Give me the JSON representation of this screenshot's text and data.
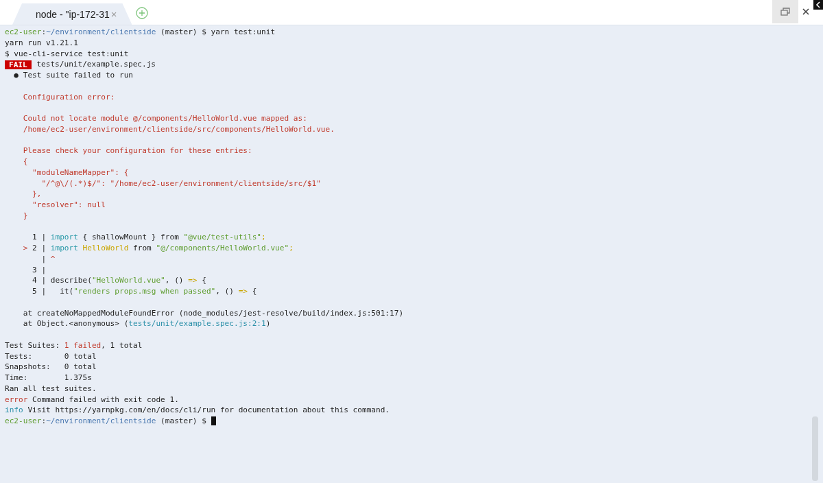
{
  "tabs": [
    {
      "title": "node - \"ip-172-31",
      "close": "×",
      "selected": true
    }
  ],
  "terminal": {
    "cursor": true,
    "lines": [
      {
        "kind": "text",
        "segments": [
          {
            "text": "ec2-user",
            "kind": "user"
          },
          {
            "text": ":",
            "kind": "plain"
          },
          {
            "text": "~/environment/clientside",
            "kind": "path"
          },
          {
            "text": " (master) $ yarn test:unit",
            "kind": "plain"
          }
        ]
      },
      {
        "kind": "text",
        "segments": [
          {
            "text": "yarn run v1.21.1",
            "kind": "plain"
          }
        ]
      },
      {
        "kind": "text",
        "segments": [
          {
            "text": "$ vue-cli-service test:unit",
            "kind": "plain"
          }
        ]
      },
      {
        "kind": "text",
        "segments": [
          {
            "text": "FAIL",
            "kind": "badge"
          },
          {
            "text": " tests/unit/example.spec.js",
            "kind": "plain"
          }
        ]
      },
      {
        "kind": "text",
        "segments": [
          {
            "text": "  ● Test suite failed to run",
            "kind": "plain"
          }
        ]
      },
      {
        "kind": "blank"
      },
      {
        "kind": "text",
        "segments": [
          {
            "text": "    Configuration error:",
            "kind": "error"
          }
        ]
      },
      {
        "kind": "blank"
      },
      {
        "kind": "text",
        "segments": [
          {
            "text": "    Could not locate module @/components/HelloWorld.vue mapped as:",
            "kind": "error"
          }
        ]
      },
      {
        "kind": "text",
        "segments": [
          {
            "text": "    /home/ec2-user/environment/clientside/src/components/HelloWorld.vue.",
            "kind": "error"
          }
        ]
      },
      {
        "kind": "blank"
      },
      {
        "kind": "text",
        "segments": [
          {
            "text": "    Please check your configuration for these entries:",
            "kind": "error"
          }
        ]
      },
      {
        "kind": "text",
        "segments": [
          {
            "text": "    {",
            "kind": "error"
          }
        ]
      },
      {
        "kind": "text",
        "segments": [
          {
            "text": "      \"moduleNameMapper\": {",
            "kind": "error"
          }
        ]
      },
      {
        "kind": "text",
        "segments": [
          {
            "text": "        \"/^@\\/(.*)$/\": \"/home/ec2-user/environment/clientside/src/$1\"",
            "kind": "error"
          }
        ]
      },
      {
        "kind": "text",
        "segments": [
          {
            "text": "      },",
            "kind": "error"
          }
        ]
      },
      {
        "kind": "text",
        "segments": [
          {
            "text": "      \"resolver\": null",
            "kind": "error"
          }
        ]
      },
      {
        "kind": "text",
        "segments": [
          {
            "text": "    }",
            "kind": "error"
          }
        ]
      },
      {
        "kind": "blank"
      },
      {
        "kind": "text",
        "segments": [
          {
            "text": "      1 | ",
            "kind": "plain"
          },
          {
            "text": "import",
            "kind": "keyword"
          },
          {
            "text": " { shallowMount } from ",
            "kind": "plain"
          },
          {
            "text": "\"@vue/test-utils\"",
            "kind": "string"
          },
          {
            "text": ";",
            "kind": "punct"
          }
        ]
      },
      {
        "kind": "text",
        "segments": [
          {
            "text": "    >",
            "kind": "error"
          },
          {
            "text": " 2 | ",
            "kind": "plain"
          },
          {
            "text": "import",
            "kind": "keyword"
          },
          {
            "text": " HelloWorld",
            "kind": "ident"
          },
          {
            "text": " from ",
            "kind": "plain"
          },
          {
            "text": "\"@/components/HelloWorld.vue\"",
            "kind": "string"
          },
          {
            "text": ";",
            "kind": "punct"
          }
        ]
      },
      {
        "kind": "text",
        "segments": [
          {
            "text": "        | ",
            "kind": "plain"
          },
          {
            "text": "^",
            "kind": "error"
          }
        ]
      },
      {
        "kind": "text",
        "segments": [
          {
            "text": "      3 |",
            "kind": "plain"
          }
        ]
      },
      {
        "kind": "text",
        "segments": [
          {
            "text": "      4 | describe(",
            "kind": "plain"
          },
          {
            "text": "\"HelloWorld.vue\"",
            "kind": "string"
          },
          {
            "text": ", () ",
            "kind": "plain"
          },
          {
            "text": "=>",
            "kind": "punct"
          },
          {
            "text": " {",
            "kind": "plain"
          }
        ]
      },
      {
        "kind": "text",
        "segments": [
          {
            "text": "      5 |   it(",
            "kind": "plain"
          },
          {
            "text": "\"renders props.msg when passed\"",
            "kind": "string"
          },
          {
            "text": ", () ",
            "kind": "plain"
          },
          {
            "text": "=>",
            "kind": "punct"
          },
          {
            "text": " {",
            "kind": "plain"
          }
        ]
      },
      {
        "kind": "blank"
      },
      {
        "kind": "text",
        "segments": [
          {
            "text": "    at createNoMappedModuleFoundError (node_modules/jest-resolve/build/index.js:501:17)",
            "kind": "plain"
          }
        ]
      },
      {
        "kind": "text",
        "segments": [
          {
            "text": "    at Object.<anonymous> (",
            "kind": "plain"
          },
          {
            "text": "tests/unit/example.spec.js:2:1",
            "kind": "link"
          },
          {
            "text": ")",
            "kind": "plain"
          }
        ]
      },
      {
        "kind": "blank"
      },
      {
        "kind": "text",
        "segments": [
          {
            "text": "Test Suites: ",
            "kind": "plain"
          },
          {
            "text": "1 failed",
            "kind": "error"
          },
          {
            "text": ", 1 total",
            "kind": "plain"
          }
        ]
      },
      {
        "kind": "text",
        "segments": [
          {
            "text": "Tests:       0 total",
            "kind": "plain"
          }
        ]
      },
      {
        "kind": "text",
        "segments": [
          {
            "text": "Snapshots:   0 total",
            "kind": "plain"
          }
        ]
      },
      {
        "kind": "text",
        "segments": [
          {
            "text": "Time:        1.375s",
            "kind": "plain"
          }
        ]
      },
      {
        "kind": "text",
        "segments": [
          {
            "text": "Ran all test suites.",
            "kind": "plain"
          }
        ]
      },
      {
        "kind": "text",
        "segments": [
          {
            "text": "error",
            "kind": "error"
          },
          {
            "text": " Command failed with exit code 1.",
            "kind": "plain"
          }
        ]
      },
      {
        "kind": "text",
        "segments": [
          {
            "text": "info",
            "kind": "link"
          },
          {
            "text": " Visit https://yarnpkg.com/en/docs/cli/run for documentation about this command.",
            "kind": "plain"
          }
        ]
      },
      {
        "kind": "prompt",
        "segments": [
          {
            "text": "ec2-user",
            "kind": "user"
          },
          {
            "text": ":",
            "kind": "plain"
          },
          {
            "text": "~/environment/clientside",
            "kind": "path"
          },
          {
            "text": " (master) $ ",
            "kind": "plain"
          }
        ]
      }
    ]
  }
}
